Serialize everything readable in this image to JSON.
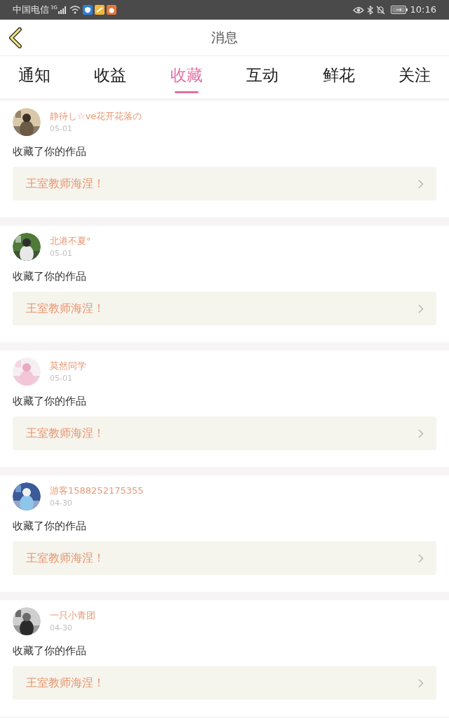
{
  "status_bar": {
    "carrier": "中国电信",
    "network": "3G",
    "time": "10:16"
  },
  "header": {
    "title": "消息"
  },
  "tabs": [
    {
      "label": "通知",
      "selected": false
    },
    {
      "label": "收益",
      "selected": false
    },
    {
      "label": "收藏",
      "selected": true
    },
    {
      "label": "互动",
      "selected": false
    },
    {
      "label": "鲜花",
      "selected": false
    },
    {
      "label": "关注",
      "selected": false
    }
  ],
  "messages": [
    {
      "user": "静待し☆ve花开花落の",
      "date": "05-01",
      "action": "收藏了你的作品",
      "work": "王室教师海涅！"
    },
    {
      "user": "北港不夏°",
      "date": "05-01",
      "action": "收藏了你的作品",
      "work": "王室教师海涅！"
    },
    {
      "user": "莫然同学",
      "date": "05-01",
      "action": "收藏了你的作品",
      "work": "王室教师海涅！"
    },
    {
      "user": "游客1588252175355",
      "date": "04-30",
      "action": "收藏了你的作品",
      "work": "王室教师海涅！"
    },
    {
      "user": "一只小青团",
      "date": "04-30",
      "action": "收藏了你的作品",
      "work": "王室教师海涅！"
    }
  ]
}
